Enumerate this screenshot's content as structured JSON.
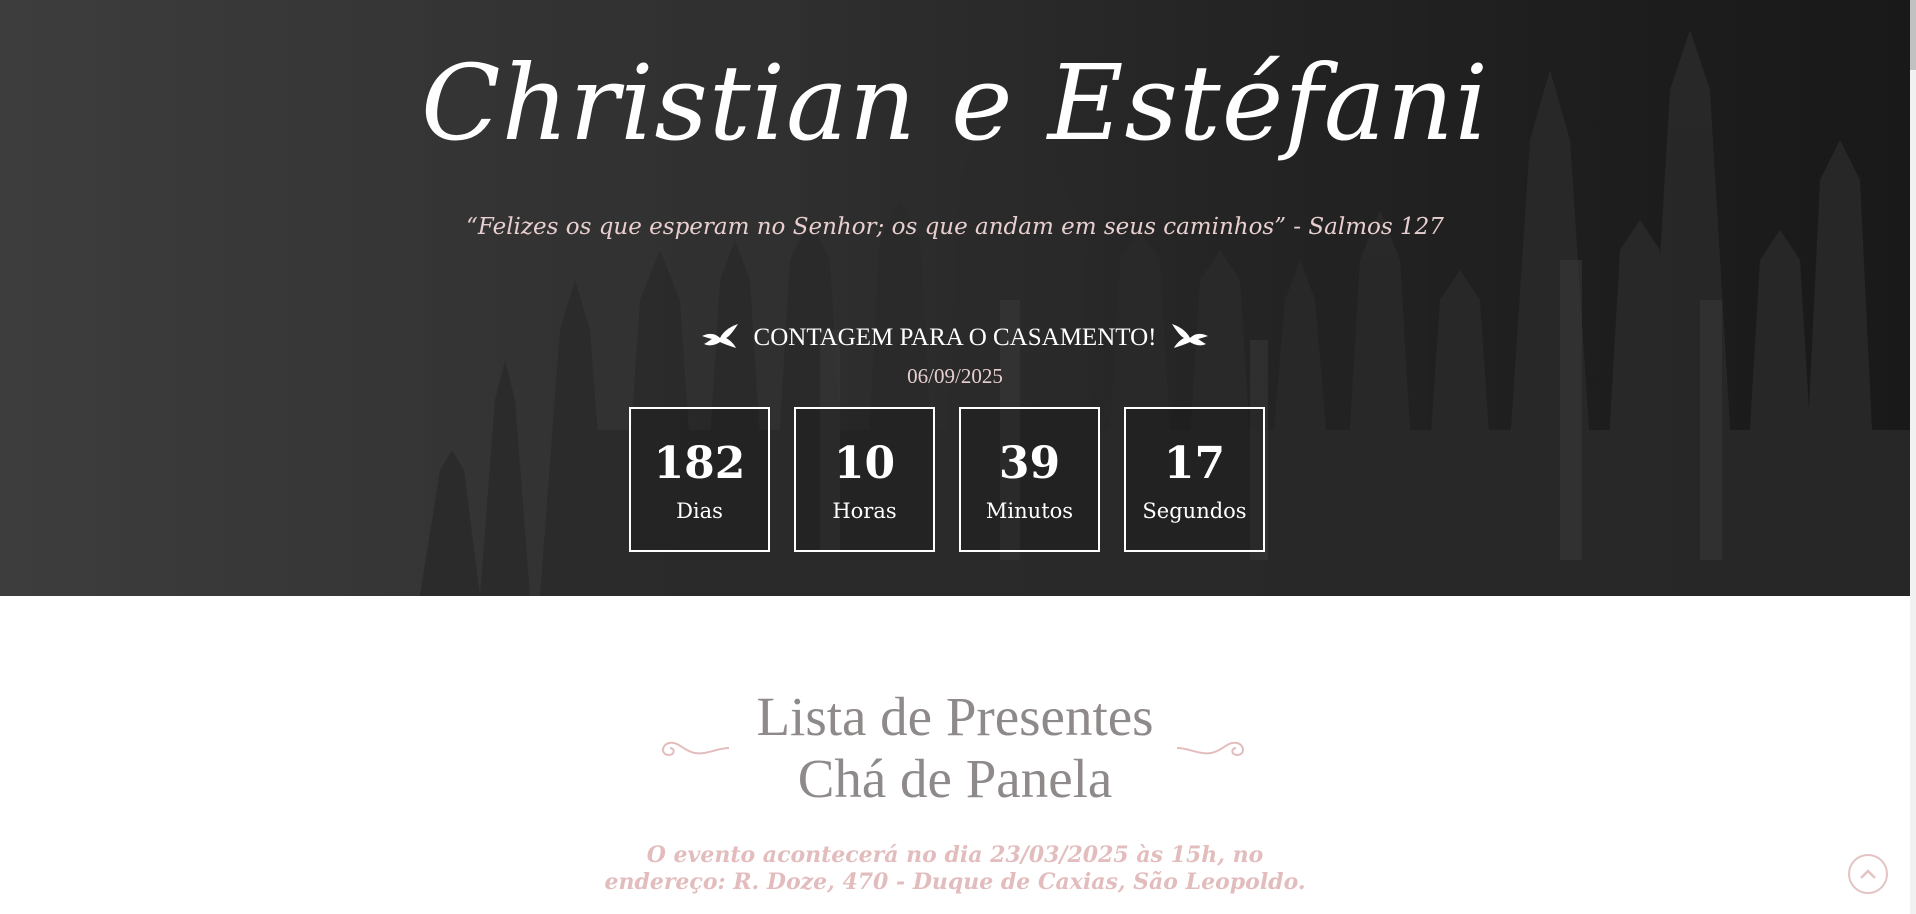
{
  "hero": {
    "title": "Christian e Estéfani",
    "quote": "“Felizes os que esperam no Senhor; os que andam em seus caminhos” - Salmos 127",
    "countdown_heading": "CONTAGEM PARA O CASAMENTO!",
    "wedding_date": "06/09/2025",
    "counters": [
      {
        "value": "182",
        "label": "Dias"
      },
      {
        "value": "10",
        "label": "Horas"
      },
      {
        "value": "39",
        "label": "Minutos"
      },
      {
        "value": "17",
        "label": "Segundos"
      }
    ]
  },
  "gift_section": {
    "title_line1": "Lista de Presentes",
    "title_line2": "Chá de Panela",
    "event_line1": "O evento acontecerá no dia 23/03/2025 às 15h, no",
    "event_line2": "endereço: R. Doze, 470 - Duque de Caxias, São Leopoldo."
  },
  "icons": {
    "dove": "dove-icon",
    "back_to_top": "chevron-up-circle-icon",
    "flourish": "flourish-ornament-icon"
  },
  "colors": {
    "accent_pink": "#e3bdbd",
    "quote_pink": "#e8cfcf",
    "heading_gray": "#8f8a8a",
    "hero_dark": "#3a3a3a"
  }
}
